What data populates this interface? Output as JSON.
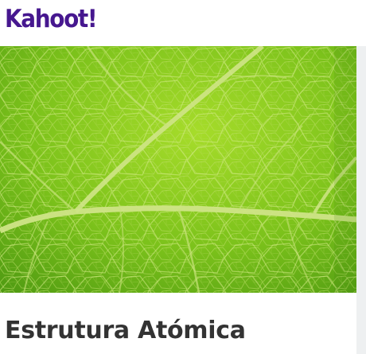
{
  "header": {
    "logo_text": "Kahoot!",
    "logo_color": "#46178f"
  },
  "kahoot": {
    "cover_image": "green-leaf-veins-photo",
    "title": "Estrutura Atómica"
  },
  "colors": {
    "leaf_green": "#7cc21b",
    "vein_color": "#c8e27a",
    "title_text": "#333333",
    "page_background": "#eef0f1"
  }
}
